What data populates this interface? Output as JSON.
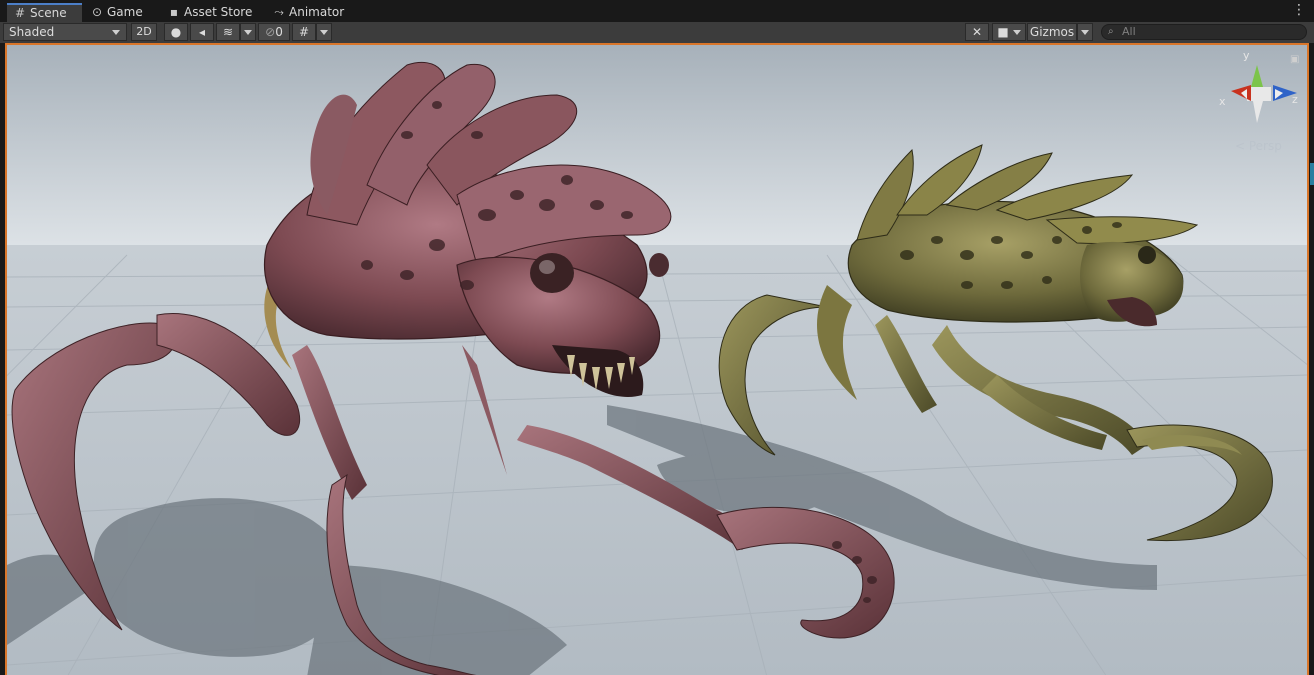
{
  "tabs": [
    {
      "label": "Scene",
      "icon": "grid-icon",
      "active": true
    },
    {
      "label": "Game",
      "icon": "gamepad-icon",
      "active": false
    },
    {
      "label": "Asset Store",
      "icon": "bag-icon",
      "active": false
    },
    {
      "label": "Animator",
      "icon": "animator-icon",
      "active": false
    }
  ],
  "toolbar": {
    "shading_mode": "Shaded",
    "mode_2d": "2D",
    "hidden_count": "0",
    "gizmos_label": "Gizmos",
    "search_placeholder": "All"
  },
  "scene_gizmo": {
    "axis_x": "x",
    "axis_y": "y",
    "axis_z": "z",
    "projection": "< Persp"
  },
  "colors": {
    "viewport_border": "#d9762a",
    "active_tab_accent": "#4c7fc8"
  }
}
